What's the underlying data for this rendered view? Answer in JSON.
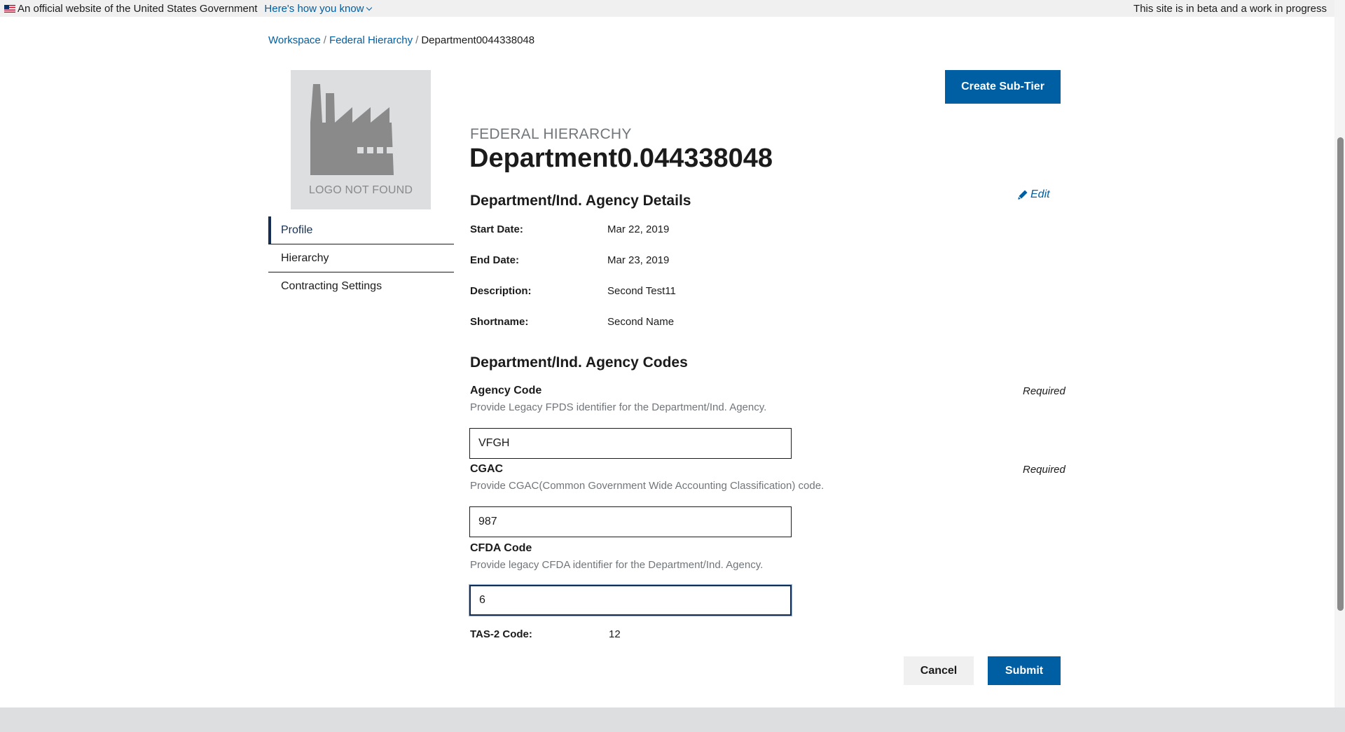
{
  "banner": {
    "official_text": "An official website of the United States Government",
    "how_link": "Here's how you know",
    "beta_text": "This site is in beta and a work in progress"
  },
  "breadcrumb": {
    "items": [
      "Workspace",
      "Federal Hierarchy"
    ],
    "separator": "/",
    "current": "Department0044338048"
  },
  "logo": {
    "placeholder_text": "LOGO NOT FOUND"
  },
  "side_nav": {
    "items": [
      "Profile",
      "Hierarchy",
      "Contracting Settings"
    ],
    "active": "Profile"
  },
  "header": {
    "eyebrow": "FEDERAL HIERARCHY",
    "title": "Department0.044338048",
    "create_button": "Create Sub-Tier"
  },
  "details": {
    "heading": "Department/Ind. Agency Details",
    "edit_label": "Edit",
    "rows": [
      {
        "label": "Start Date:",
        "value": "Mar 22, 2019"
      },
      {
        "label": "End Date:",
        "value": "Mar 23, 2019"
      },
      {
        "label": "Description:",
        "value": "Second Test11"
      },
      {
        "label": "Shortname:",
        "value": "Second Name"
      }
    ]
  },
  "codes": {
    "heading": "Department/Ind. Agency Codes",
    "required_label": "Required",
    "agency_code": {
      "label": "Agency Code",
      "hint": "Provide Legacy FPDS identifier for the Department/Ind. Agency.",
      "value": "VFGH"
    },
    "cgac": {
      "label": "CGAC",
      "hint": "Provide CGAC(Common Government Wide Accounting Classification) code.",
      "value": "987"
    },
    "cfda": {
      "label": "CFDA Code",
      "hint": "Provide legacy CFDA identifier for the Department/Ind. Agency.",
      "value": "6"
    },
    "tas2": {
      "label": "TAS-2 Code:",
      "value": "12"
    }
  },
  "actions": {
    "cancel": "Cancel",
    "submit": "Submit"
  },
  "colors": {
    "primary": "#005ea2",
    "nav_active": "#162e51",
    "muted": "#71767a",
    "logo_bg": "#dcdee0"
  }
}
